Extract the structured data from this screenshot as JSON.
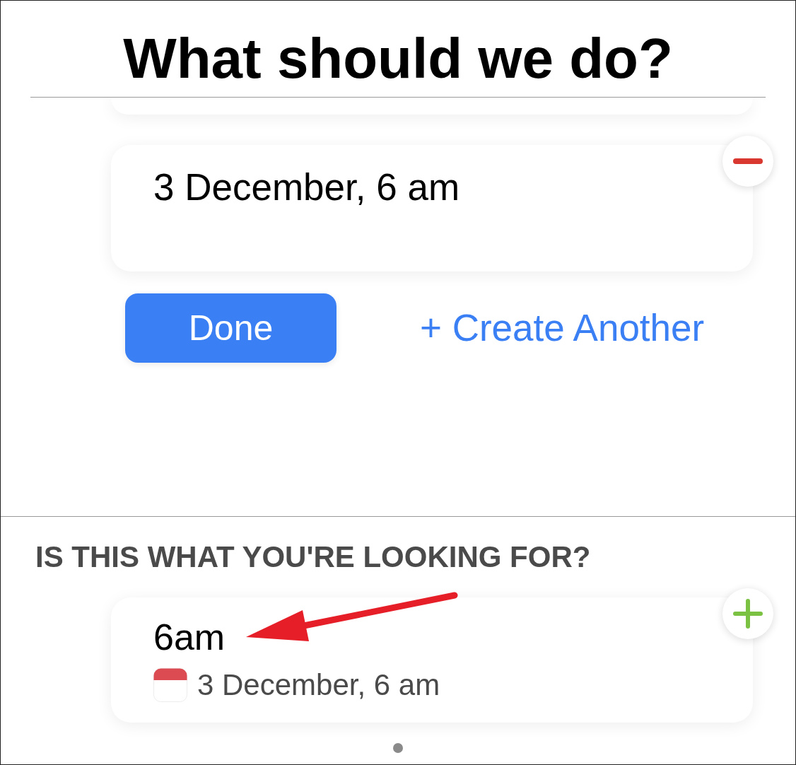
{
  "header": {
    "title": "What should we do?"
  },
  "editor": {
    "entries": [
      {
        "text": "3 December, 6 am",
        "kind": "removable"
      }
    ],
    "done_button": "Done",
    "create_link": "+ Create Another"
  },
  "suggestions": {
    "heading": "IS THIS WHAT YOU'RE LOOKING FOR?",
    "items": [
      {
        "title": "6am",
        "date": "3 December, 6 am",
        "kind": "addable"
      }
    ]
  },
  "pager": {
    "pages": [
      {
        "selected": true
      }
    ]
  }
}
